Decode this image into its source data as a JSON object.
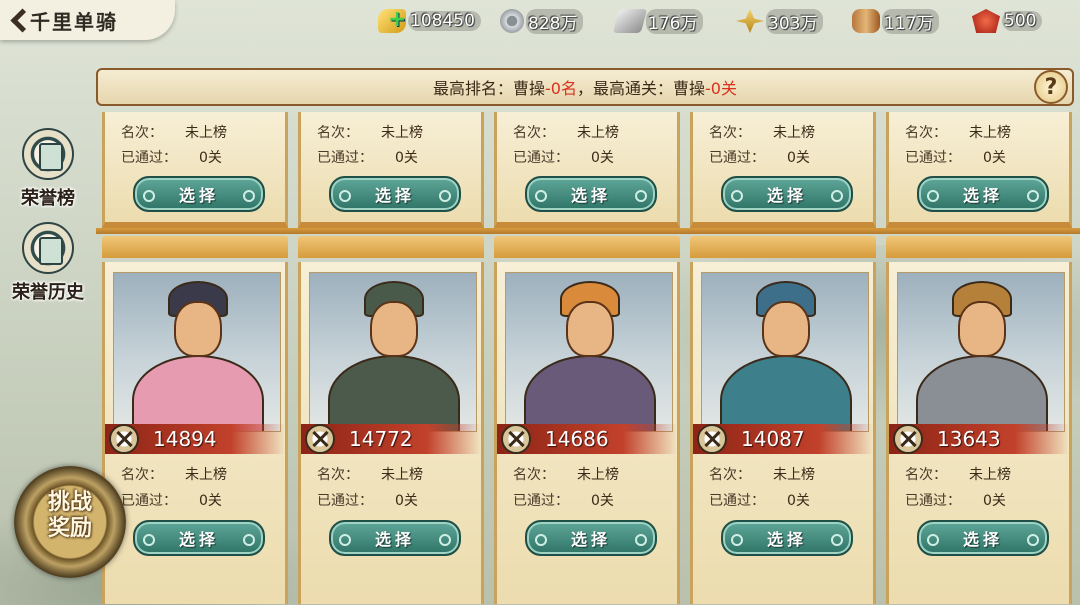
{
  "header": {
    "title": "千里单骑"
  },
  "resources": [
    {
      "name": "gold",
      "icon": "gold-ingot-plus-icon",
      "value": "108450"
    },
    {
      "name": "copper",
      "icon": "coin-icon",
      "value": "828万"
    },
    {
      "name": "iron",
      "icon": "iron-bar-icon",
      "value": "176万"
    },
    {
      "name": "grain",
      "icon": "grain-icon",
      "value": "303万"
    },
    {
      "name": "wood",
      "icon": "wood-log-icon",
      "value": "117万"
    },
    {
      "name": "token",
      "icon": "token-badge-icon",
      "value": "500"
    }
  ],
  "banner": {
    "part1": "最高排名：曹操",
    "rank": "-0名",
    "part2": "，最高通关：曹操",
    "stage": "-0关",
    "help": "?"
  },
  "side_menu": [
    {
      "label": "荣誉榜",
      "icon": "honor-scroll-icon"
    },
    {
      "label": "荣誉历史",
      "icon": "honor-history-icon"
    }
  ],
  "reward_button": {
    "line1": "挑战",
    "line2": "奖励"
  },
  "top_row": [
    {
      "rank_label": "名次：",
      "rank_value": "未上榜",
      "pass_label": "已通过：",
      "pass_value": "0关",
      "button": "选择"
    },
    {
      "rank_label": "名次：",
      "rank_value": "未上榜",
      "pass_label": "已通过：",
      "pass_value": "0关",
      "button": "选择"
    },
    {
      "rank_label": "名次：",
      "rank_value": "未上榜",
      "pass_label": "已通过：",
      "pass_value": "0关",
      "button": "选择"
    },
    {
      "rank_label": "名次：",
      "rank_value": "未上榜",
      "pass_label": "已通过：",
      "pass_value": "0关",
      "button": "选择"
    },
    {
      "rank_label": "名次：",
      "rank_value": "未上榜",
      "pass_label": "已通过：",
      "pass_value": "0关",
      "button": "选择"
    }
  ],
  "heroes": [
    {
      "power": "14894",
      "rank_label": "名次：",
      "rank_value": "未上榜",
      "pass_label": "已通过：",
      "pass_value": "0关",
      "button": "选择",
      "robe": "#e79bb1",
      "helm": "#3a3a4a"
    },
    {
      "power": "14772",
      "rank_label": "名次：",
      "rank_value": "未上榜",
      "pass_label": "已通过：",
      "pass_value": "0关",
      "button": "选择",
      "robe": "#4b5a4a",
      "helm": "#4a5a4a"
    },
    {
      "power": "14686",
      "rank_label": "名次：",
      "rank_value": "未上榜",
      "pass_label": "已通过：",
      "pass_value": "0关",
      "button": "选择",
      "robe": "#6a5a7a",
      "helm": "#d98a3a"
    },
    {
      "power": "14087",
      "rank_label": "名次：",
      "rank_value": "未上榜",
      "pass_label": "已通过：",
      "pass_value": "0关",
      "button": "选择",
      "robe": "#3d7f8a",
      "helm": "#3d6f8a"
    },
    {
      "power": "13643",
      "rank_label": "名次：",
      "rank_value": "未上榜",
      "pass_label": "已通过：",
      "pass_value": "0关",
      "button": "选择",
      "robe": "#8a8f96",
      "helm": "#b5803a"
    }
  ]
}
